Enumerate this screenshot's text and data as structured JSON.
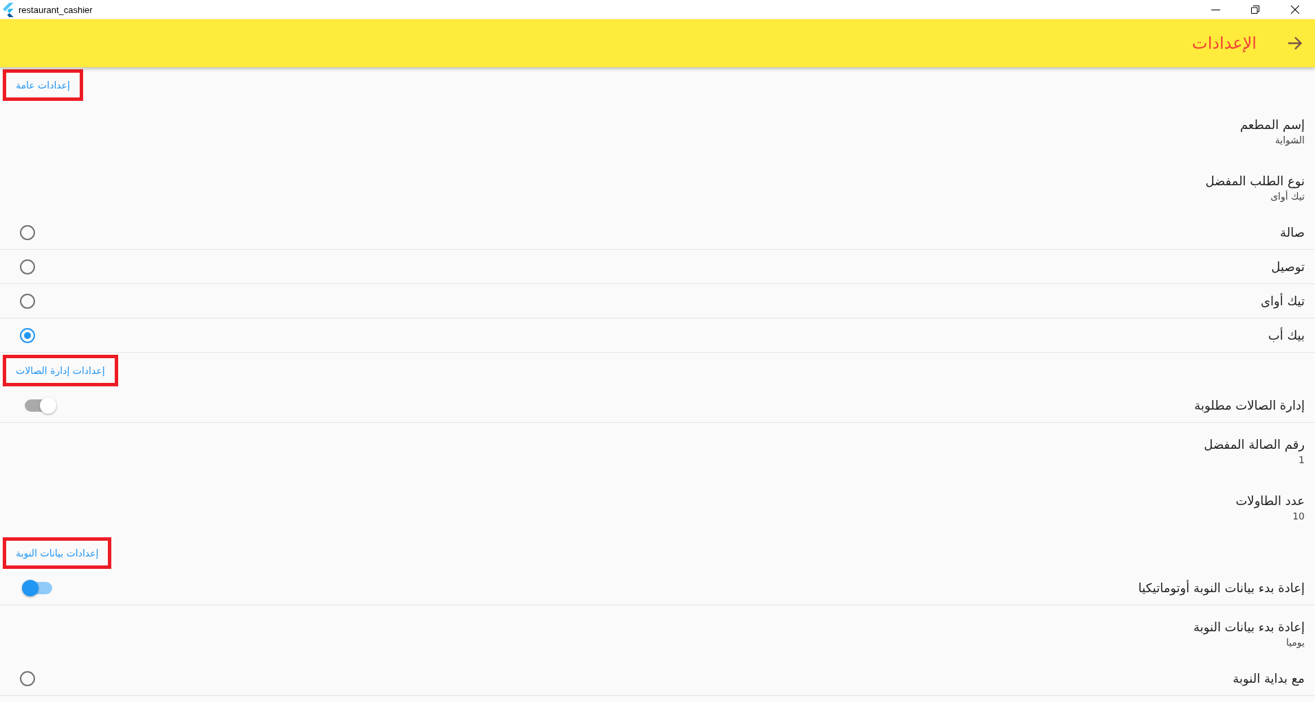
{
  "window": {
    "title": "restaurant_cashier"
  },
  "app_bar": {
    "title": "الإعدادات"
  },
  "sections": [
    {
      "title": "إعدادات عامة",
      "highlighted": true,
      "items": [
        {
          "kind": "value",
          "title": "إسم المطعم",
          "value": "الشواية"
        },
        {
          "kind": "value",
          "title": "نوع الطلب المفضل",
          "value": "تيك أواى"
        },
        {
          "kind": "radio",
          "label": "صالة",
          "selected": false
        },
        {
          "kind": "radio",
          "label": "توصيل",
          "selected": false
        },
        {
          "kind": "radio",
          "label": "تيك أواى",
          "selected": false
        },
        {
          "kind": "radio",
          "label": "بيك أب",
          "selected": true
        }
      ]
    },
    {
      "title": "إعدادات إدارة الصالات",
      "highlighted": true,
      "items": [
        {
          "kind": "switch",
          "label": "إدارة الصالات مطلوبة",
          "on": false
        },
        {
          "kind": "value",
          "title": "رقم الصالة المفضل",
          "value": "1"
        },
        {
          "kind": "value",
          "title": "عدد الطاولات",
          "value": "10"
        }
      ]
    },
    {
      "title": "إعدادات بيانات النوبة",
      "highlighted": true,
      "items": [
        {
          "kind": "switch",
          "label": "إعادة بدء بيانات النوبة أوتوماتيكيا",
          "on": true
        },
        {
          "kind": "value",
          "title": "إعادة بدء بيانات النوبة",
          "value": "يوميا"
        },
        {
          "kind": "radio",
          "label": "مع بداية النوبة",
          "selected": false
        }
      ]
    }
  ]
}
